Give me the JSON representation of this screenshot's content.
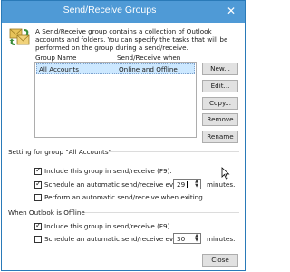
{
  "window": {
    "title": "Send/Receive Groups",
    "close_glyph": "✕"
  },
  "description": "A Send/Receive group contains a collection of Outlook accounts and folders. You can specify the tasks that will be performed on the group during a send/receive.",
  "list": {
    "columns": [
      "Group Name",
      "Send/Receive when"
    ],
    "rows": [
      {
        "name": "All Accounts",
        "when": "Online and Offline"
      }
    ]
  },
  "buttons": {
    "new": "New...",
    "edit": "Edit...",
    "copy": "Copy...",
    "remove": "Remove",
    "rename": "Rename",
    "close": "Close"
  },
  "group_settings": {
    "header": "Setting for group \"All Accounts\"",
    "include": {
      "label": "Include this group in send/receive (F9).",
      "checked": true
    },
    "schedule": {
      "label": "Schedule an automatic send/receive every",
      "checked": true,
      "value": "29",
      "unit": "minutes."
    },
    "on_exit": {
      "label": "Perform an automatic send/receive when exiting.",
      "checked": false
    }
  },
  "offline_settings": {
    "header": "When Outlook is Offline",
    "include": {
      "label": "Include this group in send/receive (F9).",
      "checked": true
    },
    "schedule": {
      "label": "Schedule an automatic send/receive every",
      "checked": false,
      "value": "30",
      "unit": "minutes."
    }
  },
  "colors": {
    "titlebar": "#4f9ad6",
    "selection": "#cce8ff",
    "button_face": "#e1e1e1"
  },
  "icons": {
    "app": "send-receive-icon",
    "cursor": "mouse-pointer-icon"
  }
}
